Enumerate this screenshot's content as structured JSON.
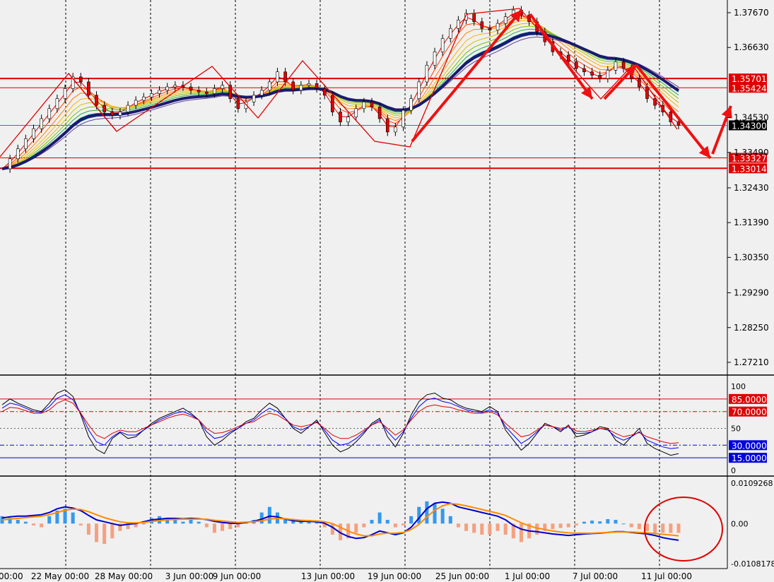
{
  "chart_data": [
    {
      "type": "candlestick",
      "title": "",
      "price_axis_ticks": [
        "1.37670",
        "1.36630",
        "1.34530",
        "1.33490",
        "1.32430",
        "1.31390",
        "1.30350",
        "1.29290",
        "1.28250",
        "1.27210"
      ],
      "horizontal_levels": [
        {
          "label": "1.35701",
          "value": 1.35701,
          "color": "#e00000"
        },
        {
          "label": "1.35424",
          "value": 1.35424,
          "color": "#e00000"
        },
        {
          "label": "1.34300",
          "value": 1.343,
          "color": "#000000"
        },
        {
          "label": "1.33327",
          "value": 1.33327,
          "color": "#e00000"
        },
        {
          "label": "1.33014",
          "value": 1.33014,
          "color": "#e00000"
        }
      ],
      "ylim": [
        1.2685,
        1.3805
      ],
      "x_tick_labels": [
        "00:00",
        "22 May 00:00",
        "28 May 00:00",
        "3 Jun 00:00",
        "9 Jun 00:00",
        "13 Jun 00:00",
        "19 Jun 00:00",
        "25 Jun 00:00",
        "1 Jul 00:00",
        "7 Jul 00:00",
        "11 Jul 00:00"
      ],
      "close_series": [
        1.33,
        1.333,
        1.336,
        1.339,
        1.342,
        1.345,
        1.348,
        1.351,
        1.354,
        1.3575,
        1.356,
        1.352,
        1.349,
        1.347,
        1.346,
        1.347,
        1.349,
        1.3505,
        1.3515,
        1.3525,
        1.3535,
        1.3545,
        1.355,
        1.3545,
        1.3535,
        1.353,
        1.3525,
        1.354,
        1.355,
        1.351,
        1.348,
        1.35,
        1.352,
        1.3535,
        1.356,
        1.359,
        1.356,
        1.3535,
        1.355,
        1.3555,
        1.354,
        1.352,
        1.347,
        1.344,
        1.3455,
        1.348,
        1.35,
        1.3485,
        1.345,
        1.341,
        1.3425,
        1.3475,
        1.351,
        1.356,
        1.361,
        1.365,
        1.369,
        1.372,
        1.3745,
        1.3765,
        1.374,
        1.372,
        1.3715,
        1.3735,
        1.3755,
        1.3775,
        1.376,
        1.374,
        1.371,
        1.368,
        1.365,
        1.364,
        1.362,
        1.36,
        1.359,
        1.358,
        1.357,
        1.3595,
        1.362,
        1.36,
        1.357,
        1.3545,
        1.351,
        1.349,
        1.347,
        1.344,
        1.343
      ]
    },
    {
      "type": "line",
      "title": "",
      "ylim": [
        0,
        100
      ],
      "levels": [
        {
          "label": "85.0000",
          "value": 85,
          "color": "#e00000"
        },
        {
          "label": "70.0000",
          "value": 70,
          "color": "#e00000"
        },
        {
          "label": "30.0000",
          "value": 30,
          "color": "#0000dd"
        },
        {
          "label": "15.0000",
          "value": 15,
          "color": "#0000dd"
        }
      ],
      "axis_ticks": [
        "100",
        "50",
        "0"
      ],
      "series": [
        {
          "color": "#000000",
          "values": [
            78,
            85,
            80,
            76,
            72,
            70,
            80,
            92,
            96,
            88,
            66,
            40,
            25,
            20,
            38,
            45,
            38,
            40,
            48,
            56,
            62,
            66,
            70,
            74,
            68,
            60,
            40,
            30,
            36,
            44,
            50,
            58,
            62,
            72,
            80,
            74,
            62,
            50,
            44,
            52,
            60,
            45,
            30,
            22,
            26,
            34,
            44,
            56,
            62,
            40,
            28,
            44,
            66,
            82,
            90,
            92,
            86,
            84,
            78,
            74,
            72,
            70,
            76,
            70,
            48,
            36,
            24,
            32,
            44,
            56,
            52,
            46,
            54,
            40,
            42,
            46,
            52,
            50,
            36,
            30,
            40,
            50,
            32,
            26,
            22,
            18,
            20
          ]
        },
        {
          "color": "#0000ff",
          "values": [
            74,
            80,
            78,
            74,
            70,
            69,
            76,
            86,
            90,
            84,
            68,
            48,
            34,
            30,
            40,
            46,
            42,
            42,
            48,
            54,
            60,
            64,
            68,
            70,
            66,
            60,
            46,
            38,
            40,
            46,
            50,
            56,
            60,
            68,
            74,
            70,
            62,
            52,
            48,
            52,
            58,
            48,
            36,
            30,
            32,
            38,
            46,
            54,
            60,
            46,
            36,
            46,
            62,
            76,
            84,
            86,
            82,
            80,
            76,
            72,
            70,
            69,
            72,
            68,
            52,
            42,
            32,
            38,
            46,
            54,
            52,
            48,
            52,
            44,
            44,
            46,
            50,
            48,
            40,
            36,
            40,
            46,
            36,
            32,
            28,
            26,
            27
          ]
        },
        {
          "color": "#e00000",
          "values": [
            70,
            75,
            74,
            71,
            68,
            68,
            72,
            80,
            84,
            80,
            68,
            54,
            42,
            38,
            44,
            48,
            46,
            46,
            50,
            54,
            58,
            62,
            65,
            67,
            64,
            60,
            50,
            44,
            45,
            48,
            52,
            56,
            58,
            64,
            68,
            66,
            60,
            54,
            52,
            54,
            57,
            50,
            42,
            38,
            38,
            42,
            48,
            54,
            58,
            50,
            42,
            48,
            60,
            70,
            76,
            78,
            76,
            75,
            72,
            70,
            68,
            68,
            70,
            66,
            56,
            48,
            40,
            42,
            48,
            54,
            52,
            50,
            52,
            47,
            46,
            48,
            50,
            49,
            44,
            40,
            42,
            45,
            40,
            37,
            34,
            32,
            33
          ]
        }
      ]
    },
    {
      "type": "bar",
      "title": "",
      "ylim": [
        -0.0108178,
        0.0109268
      ],
      "axis_ticks": [
        "0.0109268",
        "0.00",
        "-0.0108178"
      ],
      "histogram": [
        0.002,
        0.0015,
        0.001,
        0.0005,
        -0.0005,
        -0.001,
        0.002,
        0.0035,
        0.004,
        0.003,
        -0.0005,
        -0.003,
        -0.005,
        -0.0055,
        -0.004,
        -0.002,
        -0.0015,
        -0.001,
        0.0,
        0.0015,
        0.002,
        0.0015,
        0.001,
        0.0005,
        0.001,
        0.0005,
        -0.001,
        -0.0025,
        -0.002,
        -0.0015,
        -0.001,
        0.0005,
        0.001,
        0.003,
        0.0045,
        0.003,
        0.0015,
        0.001,
        0.0005,
        0.001,
        0.0005,
        -0.001,
        -0.003,
        -0.0045,
        -0.004,
        -0.0025,
        -0.001,
        0.001,
        0.003,
        0.001,
        -0.001,
        -0.0005,
        0.002,
        0.0045,
        0.006,
        0.0055,
        0.004,
        0.002,
        -0.001,
        -0.002,
        -0.0025,
        -0.003,
        -0.003,
        -0.002,
        -0.003,
        -0.004,
        -0.005,
        -0.004,
        -0.003,
        -0.002,
        -0.0015,
        -0.0012,
        -0.001,
        -0.0005,
        0.0005,
        0.0008,
        0.0006,
        0.0012,
        0.001,
        0.0,
        -0.001,
        -0.0015,
        -0.002,
        -0.0025,
        -0.0025,
        -0.0025,
        -0.0025
      ],
      "series": [
        {
          "color": "#0000cc",
          "values": [
            0.0015,
            0.0018,
            0.002,
            0.002,
            0.0022,
            0.0024,
            0.003,
            0.004,
            0.0045,
            0.0042,
            0.0035,
            0.0022,
            0.001,
            0.0005,
            0.0,
            -0.0005,
            -0.0002,
            0.0,
            0.0005,
            0.001,
            0.0012,
            0.0014,
            0.0014,
            0.0013,
            0.0014,
            0.0013,
            0.0011,
            0.0006,
            0.0003,
            0.0001,
            0.0,
            0.0003,
            0.0006,
            0.0012,
            0.002,
            0.0018,
            0.0012,
            0.0008,
            0.0006,
            0.0006,
            0.0005,
            0.0001,
            -0.001,
            -0.0025,
            -0.0035,
            -0.004,
            -0.0038,
            -0.003,
            -0.002,
            -0.0025,
            -0.003,
            -0.0025,
            -0.001,
            0.0015,
            0.004,
            0.0055,
            0.0058,
            0.0055,
            0.0045,
            0.004,
            0.0035,
            0.003,
            0.0025,
            0.002,
            0.001,
            -0.0005,
            -0.0015,
            -0.002,
            -0.0022,
            -0.0025,
            -0.0028,
            -0.003,
            -0.0032,
            -0.003,
            -0.0028,
            -0.0027,
            -0.0026,
            -0.0024,
            -0.0022,
            -0.0022,
            -0.0024,
            -0.0026,
            -0.0028,
            -0.0032,
            -0.0038,
            -0.0042,
            -0.0045
          ]
        },
        {
          "color": "#ff8c00",
          "values": [
            0.001,
            0.0012,
            0.0014,
            0.0016,
            0.0018,
            0.002,
            0.0024,
            0.003,
            0.0036,
            0.0039,
            0.0038,
            0.0032,
            0.0024,
            0.0016,
            0.001,
            0.0005,
            0.0002,
            0.0002,
            0.0003,
            0.0006,
            0.0008,
            0.001,
            0.0011,
            0.0012,
            0.0012,
            0.0012,
            0.0012,
            0.0009,
            0.0007,
            0.0005,
            0.0003,
            0.0004,
            0.0005,
            0.0008,
            0.0012,
            0.0014,
            0.0013,
            0.0011,
            0.0009,
            0.0008,
            0.0007,
            0.0005,
            0.0,
            -0.001,
            -0.002,
            -0.0028,
            -0.0033,
            -0.0033,
            -0.0028,
            -0.0026,
            -0.0026,
            -0.0024,
            -0.0016,
            -0.0002,
            0.0018,
            0.0036,
            0.0048,
            0.0054,
            0.0052,
            0.0048,
            0.0043,
            0.0038,
            0.0033,
            0.0028,
            0.0022,
            0.0012,
            0.0002,
            -0.0006,
            -0.0012,
            -0.0016,
            -0.002,
            -0.0023,
            -0.0025,
            -0.0026,
            -0.0026,
            -0.0026,
            -0.0025,
            -0.0024,
            -0.0023,
            -0.0023,
            -0.0023,
            -0.0024,
            -0.0025,
            -0.0027,
            -0.0029,
            -0.0031,
            -0.0033
          ]
        }
      ]
    }
  ]
}
